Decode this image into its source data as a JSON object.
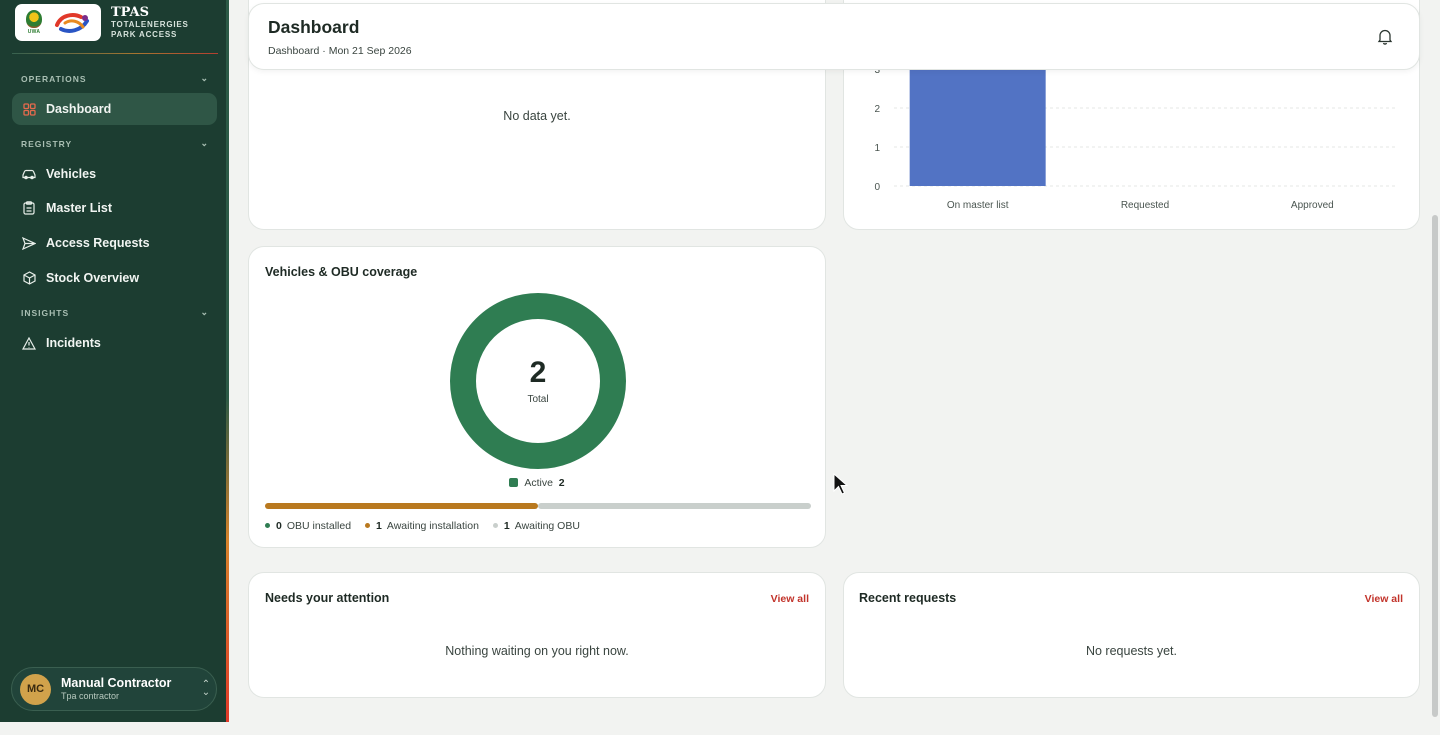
{
  "brand": {
    "title": "TPAS",
    "subtitle_line1": "TOTALENERGIES",
    "subtitle_line2": "PARK ACCESS",
    "uwa_logo_text": "UWA"
  },
  "sidebar": {
    "sections": [
      {
        "label": "OPERATIONS",
        "items": [
          {
            "label": "Dashboard",
            "icon": "grid-icon",
            "active": true
          }
        ]
      },
      {
        "label": "REGISTRY",
        "items": [
          {
            "label": "Vehicles",
            "icon": "car-icon"
          },
          {
            "label": "Master List",
            "icon": "clipboard-icon"
          },
          {
            "label": "Access Requests",
            "icon": "send-icon"
          },
          {
            "label": "Stock Overview",
            "icon": "box-icon"
          }
        ]
      },
      {
        "label": "INSIGHTS",
        "items": [
          {
            "label": "Incidents",
            "icon": "warning-icon"
          }
        ]
      }
    ]
  },
  "user": {
    "initials": "MC",
    "name": "Manual Contractor",
    "role": "Tpa contractor"
  },
  "header": {
    "title": "Dashboard",
    "breadcrumb": "Dashboard · Mon 21 Sep 2026"
  },
  "cards": {
    "top_left": {
      "empty_text": "No data yet."
    },
    "coverage": {
      "title": "Vehicles & OBU coverage",
      "total_value": "2",
      "total_label": "Total",
      "legend_label": "Active",
      "legend_value": "2",
      "stats": [
        {
          "value": "0",
          "label": "OBU installed",
          "color": "#2f7d52"
        },
        {
          "value": "1",
          "label": "Awaiting installation",
          "color": "#b9791f"
        },
        {
          "value": "1",
          "label": "Awaiting OBU",
          "color": "#c9cfcc"
        }
      ]
    },
    "attention": {
      "title": "Needs your attention",
      "link": "View all",
      "empty_text": "Nothing waiting on you right now."
    },
    "recent": {
      "title": "Recent requests",
      "link": "View all",
      "empty_text": "No requests yet."
    }
  },
  "chart_data": [
    {
      "type": "bar",
      "categories": [
        "On master list",
        "Requested",
        "Approved"
      ],
      "values": [
        3,
        0,
        0
      ],
      "ylim": [
        0,
        3
      ],
      "yticks": [
        "0",
        "1",
        "2",
        "3"
      ],
      "color": "#5273c4",
      "grid": true
    },
    {
      "type": "pie",
      "labels": [
        "Active"
      ],
      "values": [
        2
      ],
      "color": "#2f7d52",
      "center_value": "2",
      "center_label": "Total"
    },
    {
      "type": "bar",
      "orientation": "horizontal-stacked",
      "categories": [
        "Awaiting installation",
        "Awaiting OBU"
      ],
      "values": [
        1,
        1
      ],
      "colors": [
        "#b9791f",
        "#c9cfcc"
      ]
    }
  ],
  "colors": {
    "sidebar": "#1c3d31",
    "accent": "#2f7d52",
    "bar": "#5273c4",
    "link": "#c2332a"
  }
}
